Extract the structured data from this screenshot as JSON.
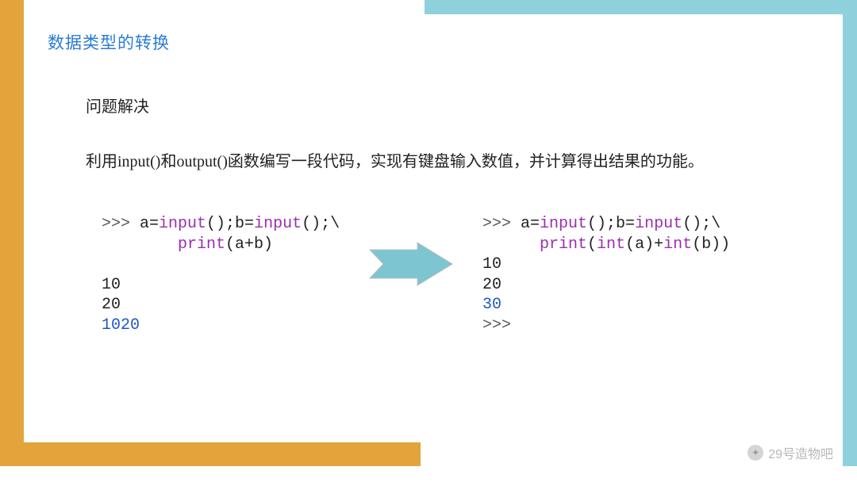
{
  "title": "数据类型的转换",
  "subtitle": "问题解决",
  "description": {
    "pre": "利用",
    "fn1": "input()",
    "mid1": "和",
    "fn2": "output()",
    "post": "函数编写一段代码，实现有键盘输入数值，并计算得出结果的功能。"
  },
  "code_left": {
    "prompt": ">>> ",
    "l1a": "a=",
    "l1b": "input",
    "l1c": "();b=",
    "l1d": "input",
    "l1e": "();\\",
    "l2a": "        ",
    "l2b": "print",
    "l2c": "(a+b)",
    "blank": "",
    "in1": "10",
    "in2": "20",
    "out": "1020"
  },
  "code_right": {
    "prompt": ">>> ",
    "l1a": "a=",
    "l1b": "input",
    "l1c": "();b=",
    "l1d": "input",
    "l1e": "();\\",
    "l2a": "      ",
    "l2b": "print",
    "l2c": "(",
    "l2d": "int",
    "l2e": "(a)+",
    "l2f": "int",
    "l2g": "(b))",
    "in1": "10",
    "in2": "20",
    "out": "30",
    "end": ">>>"
  },
  "watermark": "29号造物吧"
}
